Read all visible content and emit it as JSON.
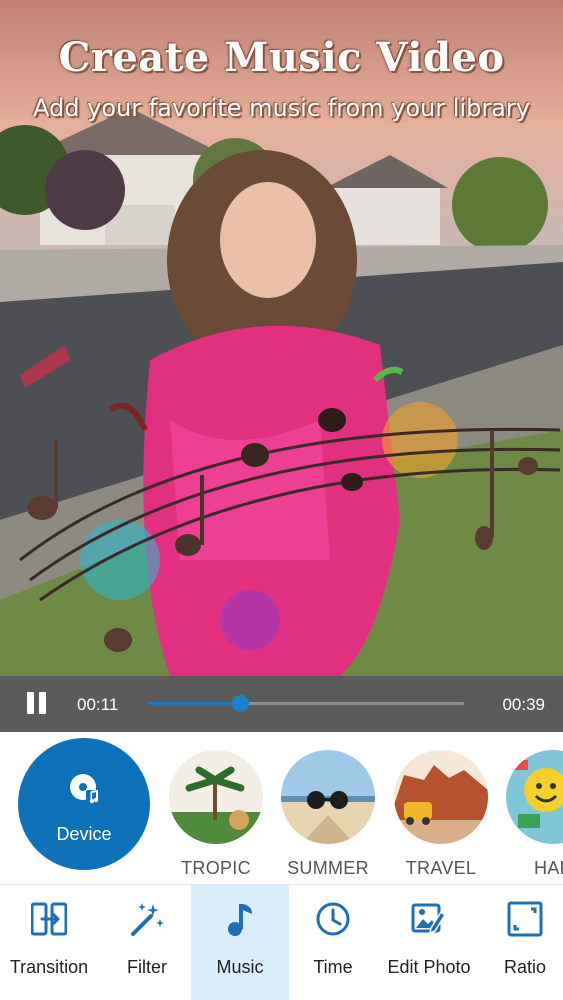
{
  "preview": {
    "title": "Create Music Video",
    "subtitle": "Add your favorite music from your library"
  },
  "player": {
    "state": "playing",
    "current_time": "00:11",
    "total_time": "00:39",
    "progress": 0.29
  },
  "music": {
    "device_label": "Device",
    "tracks": [
      {
        "label": "TROPIC",
        "icon": "tropic-thumbnail"
      },
      {
        "label": "SUMMER",
        "icon": "summer-thumbnail"
      },
      {
        "label": "TRAVEL",
        "icon": "travel-thumbnail"
      },
      {
        "label": "HAP",
        "icon": "happy-thumbnail"
      }
    ]
  },
  "toolbar": {
    "active": "Music",
    "accent": "#1f6fb4",
    "items": [
      {
        "label": "Transition",
        "icon": "transition-icon"
      },
      {
        "label": "Filter",
        "icon": "magic-wand-icon"
      },
      {
        "label": "Music",
        "icon": "music-note-icon"
      },
      {
        "label": "Time",
        "icon": "clock-icon"
      },
      {
        "label": "Edit Photo",
        "icon": "edit-photo-icon"
      },
      {
        "label": "Ratio",
        "icon": "ratio-icon"
      }
    ]
  }
}
